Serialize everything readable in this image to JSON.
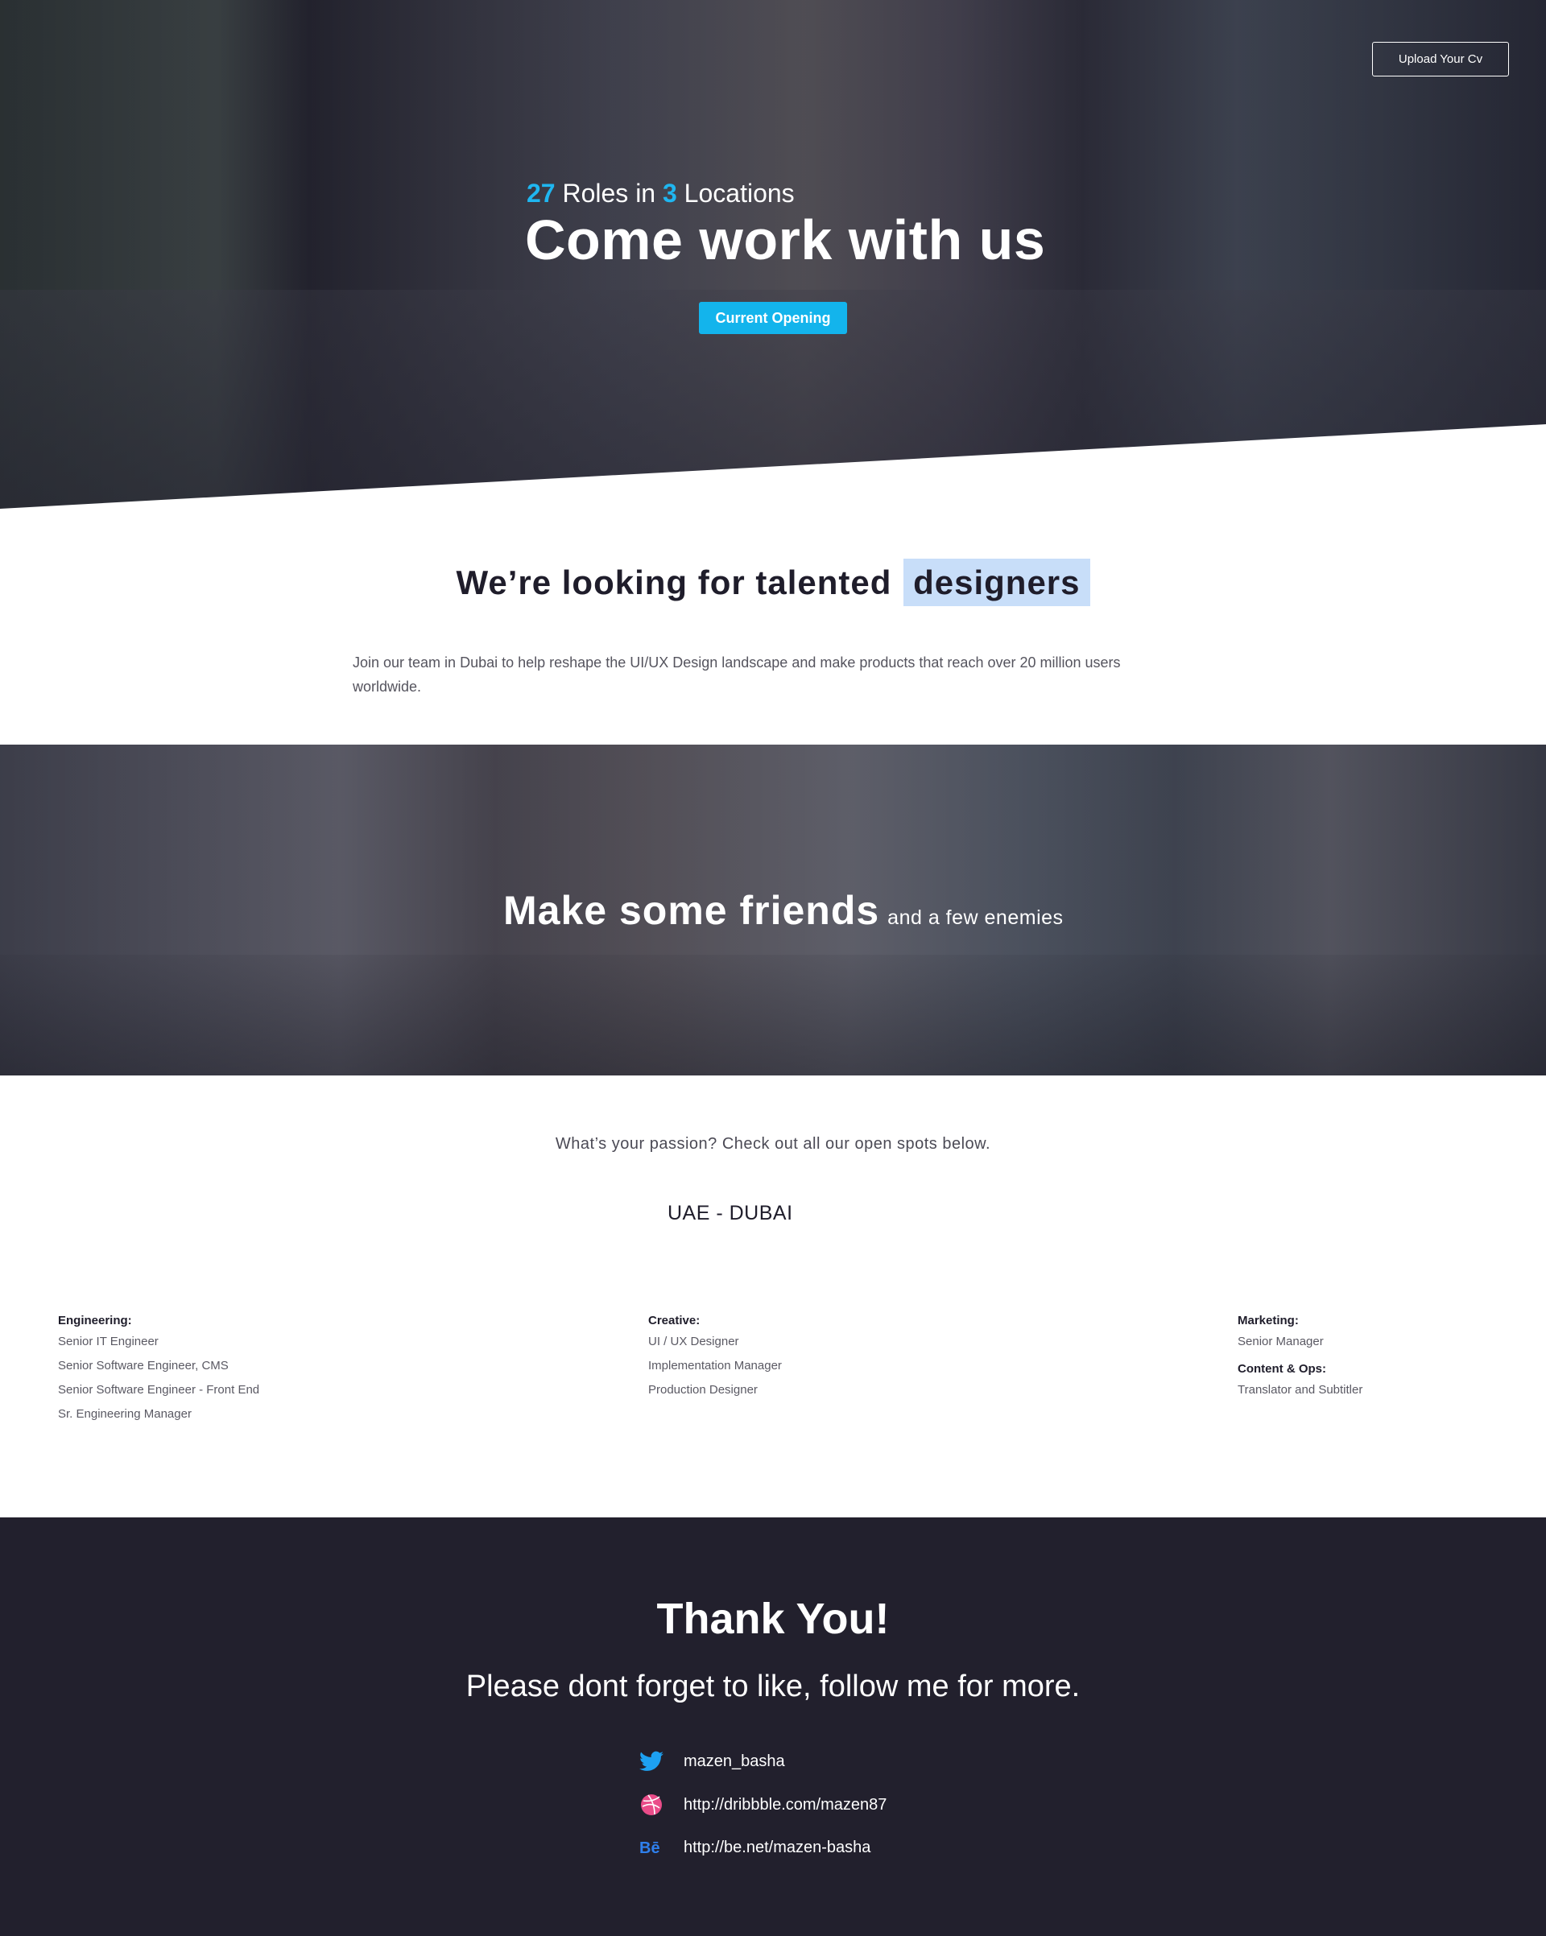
{
  "hero": {
    "upload_label": "Upload Your Cv",
    "roles_count": "27",
    "roles_word": " Roles in ",
    "locations_count": "3",
    "locations_word": " Locations",
    "title": "Come work with us",
    "cta_label": "Current Opening"
  },
  "intro": {
    "heading_start": "We’re looking for talented",
    "heading_highlight": "designers",
    "text": "Join our team in Dubai to help reshape the UI/UX Design landscape and make products that reach over 20 million users worldwide."
  },
  "friends": {
    "title": "Make some friends",
    "subtitle": "and a few enemies"
  },
  "openings": {
    "passion": "What’s your passion? Check out all our open spots below.",
    "location": "UAE - DUBAI",
    "engineering": {
      "title": "Engineering:",
      "items": [
        "Senior IT Engineer",
        "Senior Software Engineer, CMS",
        "Senior Software Engineer - Front End",
        "Sr. Engineering Manager"
      ]
    },
    "creative": {
      "title": "Creative:",
      "items": [
        "UI / UX Designer",
        "Implementation Manager",
        "Production Designer"
      ]
    },
    "marketing": {
      "title": "Marketing:",
      "items": [
        "Senior Manager"
      ]
    },
    "content": {
      "title": "Content & Ops:",
      "items": [
        "Translator and Subtitler"
      ]
    }
  },
  "footer": {
    "thanks": "Thank You!",
    "follow": "Please dont forget to like, follow me for more.",
    "social": [
      {
        "icon": "twitter-icon",
        "text": "mazen_basha",
        "color": "#1da1f2"
      },
      {
        "icon": "dribbble-icon",
        "text": "http://dribbble.com/mazen87",
        "color": "#ea4c89"
      },
      {
        "icon": "behance-icon",
        "text": "http://be.net/mazen-basha",
        "color": "#2f80ed"
      }
    ]
  },
  "colors": {
    "accent": "#13b4ec",
    "highlight": "#c8def9",
    "footer_bg": "#22202d",
    "text_dark": "#1f1d2b"
  }
}
